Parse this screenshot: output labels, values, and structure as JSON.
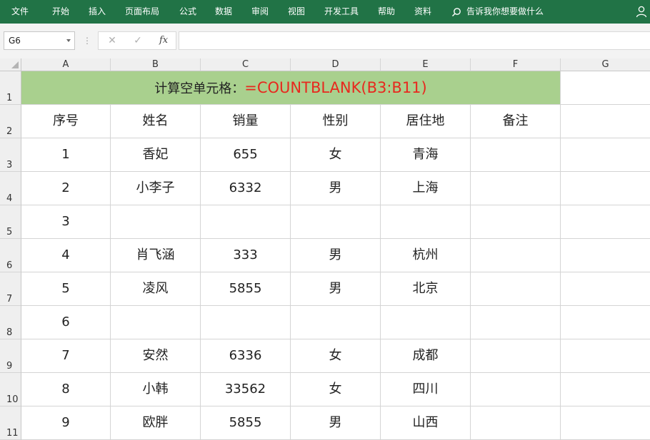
{
  "ribbon": {
    "tabs": [
      "文件",
      "开始",
      "插入",
      "页面布局",
      "公式",
      "数据",
      "审阅",
      "视图",
      "开发工具",
      "帮助",
      "资料"
    ],
    "tell_me": "告诉我你想要做什么"
  },
  "formula_bar": {
    "name_box": "G6",
    "fx_label": "fx",
    "formula": ""
  },
  "columns": [
    "A",
    "B",
    "C",
    "D",
    "E",
    "F",
    "G"
  ],
  "rows": [
    "1",
    "2",
    "3",
    "4",
    "5",
    "6",
    "7",
    "8",
    "9",
    "10",
    "11"
  ],
  "sheet": {
    "title_label": "计算空单元格：",
    "title_formula": "=COUNTBLANK(B3:B11)",
    "headers": [
      "序号",
      "姓名",
      "销量",
      "性别",
      "居住地",
      "备注"
    ],
    "records": [
      [
        "1",
        "香妃",
        "655",
        "女",
        "青海",
        ""
      ],
      [
        "2",
        "小李子",
        "6332",
        "男",
        "上海",
        ""
      ],
      [
        "3",
        "",
        "",
        "",
        "",
        ""
      ],
      [
        "4",
        "肖飞涵",
        "333",
        "男",
        "杭州",
        ""
      ],
      [
        "5",
        "凌风",
        "5855",
        "男",
        "北京",
        ""
      ],
      [
        "6",
        "",
        "",
        "",
        "",
        ""
      ],
      [
        "7",
        "安然",
        "6336",
        "女",
        "成都",
        ""
      ],
      [
        "8",
        "小韩",
        "33562",
        "女",
        "四川",
        ""
      ],
      [
        "9",
        "欧胖",
        "5855",
        "男",
        "山西",
        ""
      ]
    ]
  },
  "colors": {
    "ribbon": "#217346",
    "title_fill": "#a9d08e",
    "formula_text": "#e8281e"
  }
}
